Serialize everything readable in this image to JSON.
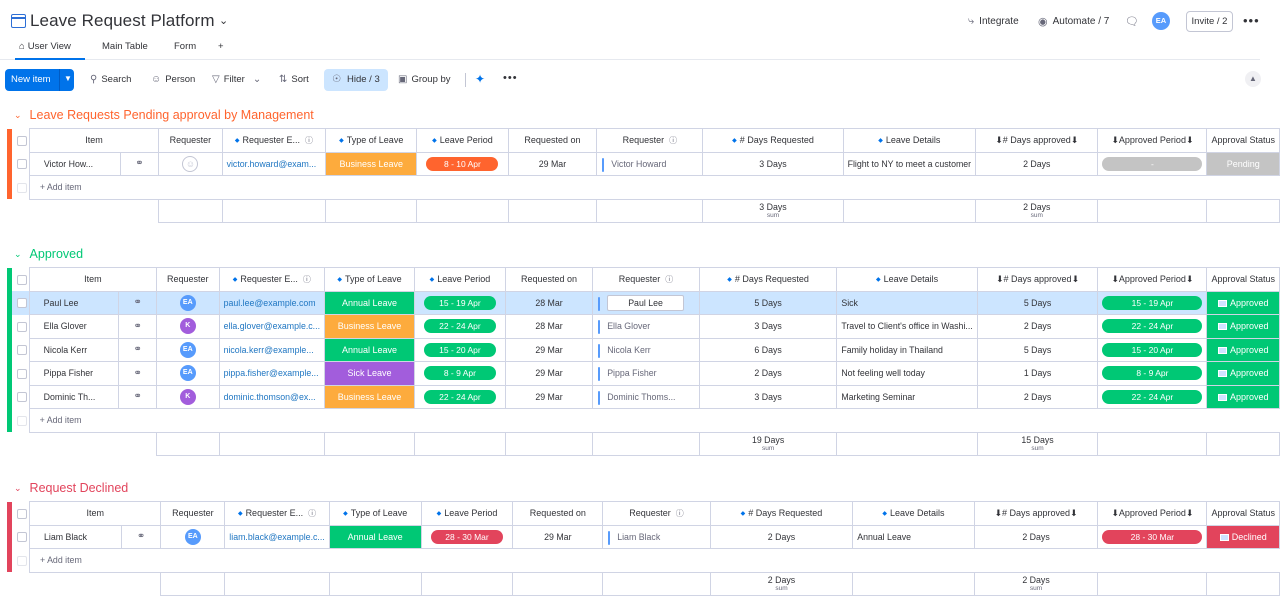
{
  "header": {
    "title": "Leave Request Platform",
    "integrate": "Integrate",
    "automate": "Automate / 7",
    "avatar_initials": "EA",
    "invite": "Invite / 2"
  },
  "tabs": [
    {
      "label": "User View",
      "active": true
    },
    {
      "label": "Main Table"
    },
    {
      "label": "Form"
    },
    {
      "label": "+"
    }
  ],
  "toolbar": {
    "new_item": "New item",
    "search": "Search",
    "person": "Person",
    "filter": "Filter",
    "sort": "Sort",
    "hide": "Hide / 3",
    "group_by": "Group by"
  },
  "columns": {
    "item": "Item",
    "requester": "Requester",
    "requester_email": "Requester E...",
    "type_of_leave": "Type of Leave",
    "leave_period": "Leave Period",
    "requested_on": "Requested on",
    "requester2": "Requester",
    "days_requested": "# Days Requested",
    "leave_details": "Leave Details",
    "days_approved": "⬇# Days approved⬇",
    "approved_period": "⬇Approved Period⬇",
    "approval_status": "Approval Status"
  },
  "add_item": "+ Add item",
  "sum_label": "sum",
  "colors": {
    "business": "#fdab3d",
    "annual": "#00c875",
    "sick": "#a25ddc",
    "period_orange": "#ff642e",
    "period_green": "#00c875",
    "period_red": "#e2445c",
    "approved": "#00c875",
    "pending": "#c4c4c4",
    "declined": "#e2445c"
  },
  "groups": [
    {
      "title": "Leave Requests Pending approval by Management",
      "color": "#ff642e",
      "rows": [
        {
          "item": "Victor How...",
          "avatar": "",
          "email": "victor.howard@exam...",
          "type": "Business Leave",
          "type_color": "#fdab3d",
          "period": "8 - 10 Apr",
          "period_color": "#ff642e",
          "requested_on": "29 Mar",
          "requester": "Victor Howard",
          "days_req": "3 Days",
          "details": "Flight to NY to meet a customer",
          "days_appr": "2 Days",
          "appr_period": "-",
          "appr_period_color": "#c4c4c4",
          "status": "Pending",
          "status_color": "#c4c4c4"
        }
      ],
      "sum_days_req": "3 Days",
      "sum_days_appr": "2 Days"
    },
    {
      "title": "Approved",
      "color": "#00c875",
      "rows": [
        {
          "item": "Paul Lee",
          "avatar": "EA",
          "avatar_color": "#579bfc",
          "email": "paul.lee@example.com",
          "type": "Annual Leave",
          "type_color": "#00c875",
          "period": "15 - 19 Apr",
          "period_color": "#00c875",
          "requested_on": "28 Mar",
          "requester": "Paul Lee",
          "days_req": "5 Days",
          "details": "Sick",
          "days_appr": "5 Days",
          "appr_period": "15 - 19 Apr",
          "appr_period_color": "#00c875",
          "status": "Approved",
          "status_color": "#00c875",
          "selected": true
        },
        {
          "item": "Ella Glover",
          "avatar": "K",
          "avatar_color": "#a25ddc",
          "email": "ella.glover@example.c...",
          "type": "Business Leave",
          "type_color": "#fdab3d",
          "period": "22 - 24 Apr",
          "period_color": "#00c875",
          "requested_on": "28 Mar",
          "requester": "Ella Glover",
          "days_req": "3 Days",
          "details": "Travel to Client's office in Washi...",
          "days_appr": "2 Days",
          "appr_period": "22 - 24 Apr",
          "appr_period_color": "#00c875",
          "status": "Approved",
          "status_color": "#00c875"
        },
        {
          "item": "Nicola Kerr",
          "avatar": "EA",
          "avatar_color": "#579bfc",
          "email": "nicola.kerr@example...",
          "type": "Annual Leave",
          "type_color": "#00c875",
          "period": "15 - 20 Apr",
          "period_color": "#00c875",
          "requested_on": "29 Mar",
          "requester": "Nicola Kerr",
          "days_req": "6 Days",
          "details": "Family holiday in Thailand",
          "days_appr": "5 Days",
          "appr_period": "15 - 20 Apr",
          "appr_period_color": "#00c875",
          "status": "Approved",
          "status_color": "#00c875"
        },
        {
          "item": "Pippa Fisher",
          "avatar": "EA",
          "avatar_color": "#579bfc",
          "email": "pippa.fisher@example...",
          "type": "Sick Leave",
          "type_color": "#a25ddc",
          "period": "8 - 9 Apr",
          "period_color": "#00c875",
          "requested_on": "29 Mar",
          "requester": "Pippa Fisher",
          "days_req": "2 Days",
          "details": "Not feeling well today",
          "days_appr": "1 Days",
          "appr_period": "8 - 9 Apr",
          "appr_period_color": "#00c875",
          "status": "Approved",
          "status_color": "#00c875"
        },
        {
          "item": "Dominic Th...",
          "avatar": "K",
          "avatar_color": "#a25ddc",
          "email": "dominic.thomson@ex...",
          "type": "Business Leave",
          "type_color": "#fdab3d",
          "period": "22 - 24 Apr",
          "period_color": "#00c875",
          "requested_on": "29 Mar",
          "requester": "Dominic Thoms...",
          "days_req": "3 Days",
          "details": "Marketing Seminar",
          "days_appr": "2 Days",
          "appr_period": "22 - 24 Apr",
          "appr_period_color": "#00c875",
          "status": "Approved",
          "status_color": "#00c875"
        }
      ],
      "sum_days_req": "19 Days",
      "sum_days_appr": "15 Days"
    },
    {
      "title": "Request Declined",
      "color": "#e2445c",
      "rows": [
        {
          "item": "Liam Black",
          "avatar": "EA",
          "avatar_color": "#579bfc",
          "email": "liam.black@example.c...",
          "type": "Annual Leave",
          "type_color": "#00c875",
          "period": "28 - 30 Mar",
          "period_color": "#e2445c",
          "requested_on": "29 Mar",
          "requester": "Liam Black",
          "days_req": "2 Days",
          "details": "Annual Leave",
          "days_appr": "2 Days",
          "appr_period": "28 - 30 Mar",
          "appr_period_color": "#e2445c",
          "status": "Declined",
          "status_color": "#e2445c"
        }
      ],
      "sum_days_req": "2 Days",
      "sum_days_appr": "2 Days"
    }
  ]
}
